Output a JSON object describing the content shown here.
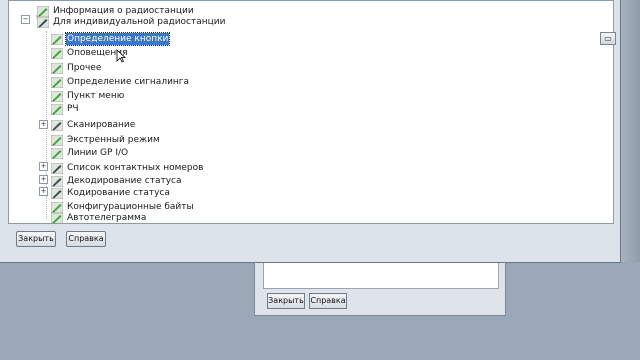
{
  "main_window": {
    "tree": {
      "items": [
        {
          "label": "Информация о радиостанции",
          "icon": "pencil-icon",
          "expander": "",
          "selected": false
        },
        {
          "label": "Для индивидуальной радиостанции",
          "icon": "pencil-icon",
          "expander": "-",
          "selected": false
        },
        {
          "label": "Определение кнопки",
          "icon": "pencil-icon",
          "expander": "",
          "selected": true
        },
        {
          "label": "Оповещения",
          "icon": "pencil-icon",
          "expander": "",
          "selected": false
        },
        {
          "label": "Прочее",
          "icon": "pencil-icon",
          "expander": "",
          "selected": false
        },
        {
          "label": "Определение сигналинга",
          "icon": "pencil-icon",
          "expander": "",
          "selected": false
        },
        {
          "label": "Пункт меню",
          "icon": "pencil-icon",
          "expander": "",
          "selected": false
        },
        {
          "label": "РЧ",
          "icon": "pencil-icon",
          "expander": "",
          "selected": false
        },
        {
          "label": "Сканирование",
          "icon": "pencil-icon",
          "expander": "+",
          "selected": false
        },
        {
          "label": "Экстренный режим",
          "icon": "pencil-icon",
          "expander": "",
          "selected": false
        },
        {
          "label": "Линии GP I/O",
          "icon": "pencil-icon",
          "expander": "",
          "selected": false
        },
        {
          "label": "Список контактных номеров",
          "icon": "pencil-icon",
          "expander": "+",
          "selected": false
        },
        {
          "label": "Декодирование статуса",
          "icon": "pencil-icon",
          "expander": "+",
          "selected": false
        },
        {
          "label": "Кодирование статуса",
          "icon": "pencil-icon",
          "expander": "+",
          "selected": false
        },
        {
          "label": "Конфигурационные байты",
          "icon": "pencil-icon",
          "expander": "",
          "selected": false
        },
        {
          "label": "Автотелеграмма",
          "icon": "pencil-icon",
          "expander": "",
          "selected": false
        }
      ]
    },
    "buttons": {
      "close_label": "Закрыть",
      "help_label": "Справка"
    }
  },
  "back_dialog": {
    "buttons": {
      "close_label": "Закрыть",
      "help_label": "Справка"
    }
  },
  "colors": {
    "selection": "#3a75cf",
    "icon_green": "#3fa63a"
  }
}
